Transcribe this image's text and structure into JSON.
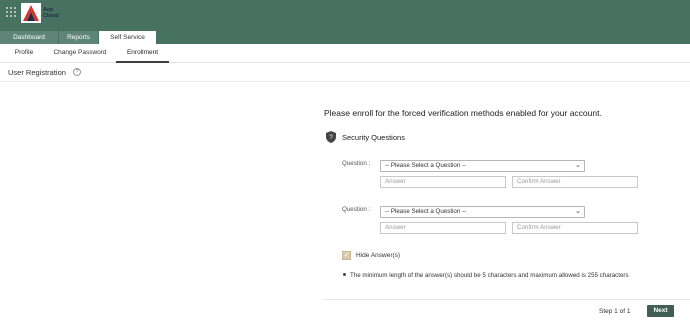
{
  "brand": {
    "line1": "Ace",
    "line2": "Cloud",
    "accent": "#d0362b",
    "dark": "#1f2a48"
  },
  "colors": {
    "header_bg": "#477262",
    "next_button": "#3f5f55",
    "checkbox": "#d9cbb0"
  },
  "nav": {
    "tabs": [
      {
        "label": "Dashboard",
        "active": false
      },
      {
        "label": "Reports",
        "active": false
      },
      {
        "label": "Self Service",
        "active": true
      }
    ]
  },
  "subnav": {
    "tabs": [
      {
        "label": "Profile",
        "active": false
      },
      {
        "label": "Change Password",
        "active": false
      },
      {
        "label": "Enrollment",
        "active": true
      }
    ]
  },
  "page": {
    "title": "User Registration",
    "help_icon": "question-circle-icon"
  },
  "enroll": {
    "heading": "Please enroll for the forced verification methods enabled for your account.",
    "section_title": "Security Questions",
    "section_icon": "shield-icon",
    "questions": [
      {
        "label": "Question :",
        "selected": "-- Please Select a Question --",
        "answer_placeholder": "Answer",
        "confirm_placeholder": "Confirm Answer"
      },
      {
        "label": "Question :",
        "selected": "-- Please Select a Question --",
        "answer_placeholder": "Answer",
        "confirm_placeholder": "Confirm Answer"
      }
    ],
    "hide_answers": {
      "label": "Hide Answer(s)",
      "checked": true
    },
    "note": "The minimum length of the answer(s) should be 5 characters and maximum allowed is 255 characters"
  },
  "footer": {
    "step": "Step 1 of 1",
    "next_label": "Next"
  }
}
